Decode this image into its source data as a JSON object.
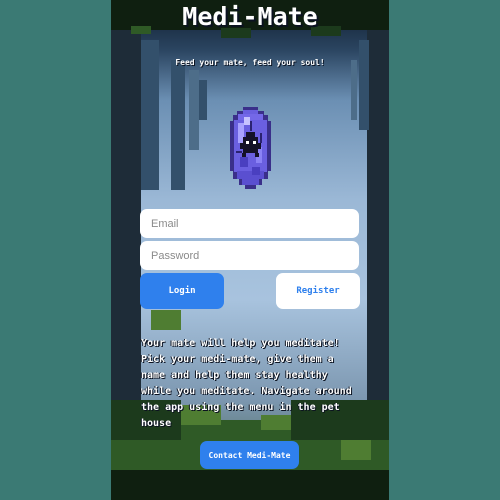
{
  "app": {
    "title": "Medi-Mate",
    "tagline": "Feed your mate, feed your soul!"
  },
  "login_form": {
    "email_placeholder": "Email",
    "password_placeholder": "Password",
    "login_label": "Login",
    "register_label": "Register"
  },
  "description": "Your mate will help you meditate! Pick your medi-mate, give them a name and help them stay healthy while you meditate. Navigate around the app using the menu in the pet house",
  "contact": {
    "label": "Contact Medi-Mate"
  },
  "colors": {
    "page_background": "#3b7a74",
    "accent": "#2f80ed",
    "pet_purple": "#6a5fe0"
  },
  "icons": {
    "pet": "crystal-egg-pet-icon"
  }
}
